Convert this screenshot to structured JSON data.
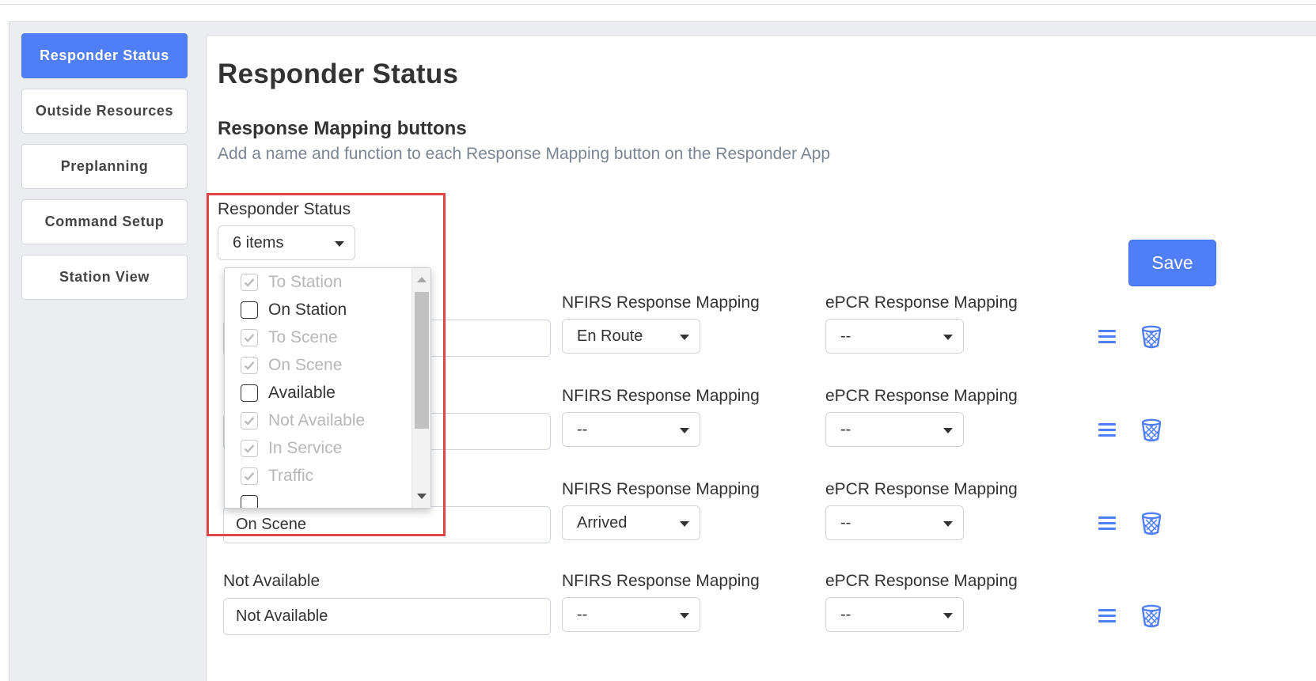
{
  "sidebar": {
    "items": [
      {
        "label": "Responder Status",
        "active": true
      },
      {
        "label": "Outside Resources"
      },
      {
        "label": "Preplanning"
      },
      {
        "label": "Command Setup"
      },
      {
        "label": "Station View"
      }
    ]
  },
  "main": {
    "page_title": "Responder Status",
    "section_title": "Response Mapping buttons",
    "section_subtitle": "Add a name and function to each Response Mapping button on the Responder App",
    "filter_label": "Responder Status",
    "filter_value": "6 items",
    "save_label": "Save",
    "rows": [
      {
        "name_label": "",
        "name_value": "",
        "nfirs_label": "NFIRS Response Mapping",
        "nfirs_value": "En Route",
        "epcr_label": "ePCR Response Mapping",
        "epcr_value": "--"
      },
      {
        "name_label": "",
        "name_value": "",
        "nfirs_label": "NFIRS Response Mapping",
        "nfirs_value": "--",
        "epcr_label": "ePCR Response Mapping",
        "epcr_value": "--"
      },
      {
        "name_label": "",
        "name_value": "On Scene",
        "nfirs_label": "NFIRS Response Mapping",
        "nfirs_value": "Arrived",
        "epcr_label": "ePCR Response Mapping",
        "epcr_value": "--"
      },
      {
        "name_label": "Not Available",
        "name_value": "Not Available",
        "nfirs_label": "NFIRS Response Mapping",
        "nfirs_value": "--",
        "epcr_label": "ePCR Response Mapping",
        "epcr_value": "--"
      }
    ]
  },
  "dropdown": {
    "options": [
      {
        "label": "To Station",
        "checked": true,
        "disabled": true
      },
      {
        "label": "On Station",
        "checked": false,
        "disabled": false
      },
      {
        "label": "To Scene",
        "checked": true,
        "disabled": true
      },
      {
        "label": "On Scene",
        "checked": true,
        "disabled": true
      },
      {
        "label": "Available",
        "checked": false,
        "disabled": false
      },
      {
        "label": "Not Available",
        "checked": true,
        "disabled": true
      },
      {
        "label": "In Service",
        "checked": true,
        "disabled": true
      },
      {
        "label": "Traffic",
        "checked": true,
        "disabled": true
      },
      {
        "label": "",
        "checked": false,
        "disabled": false
      }
    ]
  },
  "icons": {
    "reorder": "hamburger-icon",
    "delete": "trash-icon"
  },
  "colors": {
    "accent": "#4f7ef8",
    "highlight": "#e04444",
    "disabled_text": "#b7b7b7"
  }
}
